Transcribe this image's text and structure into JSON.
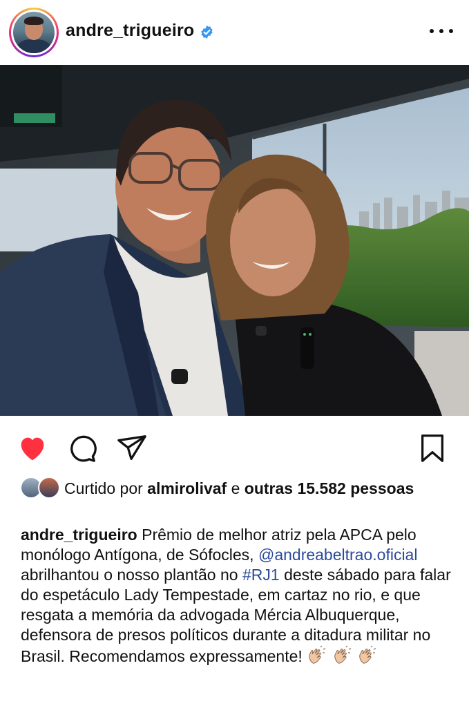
{
  "post": {
    "username": "andre_trigueiro",
    "verified": true,
    "more_icon": "more-horizontal-icon"
  },
  "photo": {
    "alt_icon": "photo"
  },
  "actions": {
    "like_icon": "heart-filled-icon",
    "comment_icon": "comment-icon",
    "share_icon": "send-icon",
    "save_icon": "bookmark-icon",
    "like_color": "#ff3040"
  },
  "likes": {
    "prefix": "Curtido por",
    "user": "almirolivaf",
    "joiner": "e",
    "others": "outras 15.582",
    "suffix": "pessoas"
  },
  "caption": {
    "username": "andre_trigueiro",
    "text_1": "Prêmio de melhor atriz pela APCA pelo monólogo Antígona, de Sófocles,",
    "mention": "@andreabeltrao.oficial",
    "text_2": "abrilhantou o nosso plantão no",
    "hashtag": "#RJ1",
    "text_3": "deste sábado para falar do espetáculo Lady Tempestade, em cartaz no rio, e que resgata a memória da advogada Mércia Albuquerque, defensora de presos políticos durante a ditadura militar no Brasil. Recomendamos expressamente!",
    "emojis": "clapping-hands-emoji x3"
  }
}
